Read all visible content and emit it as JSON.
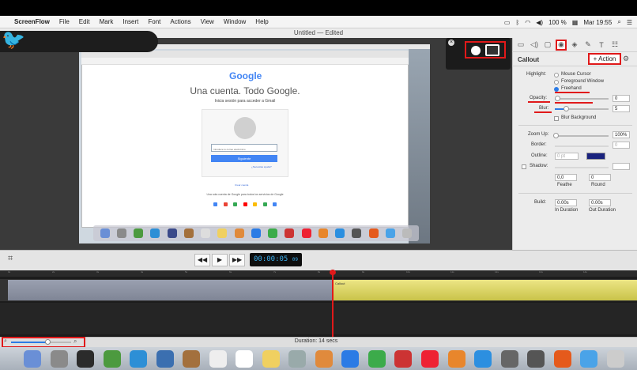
{
  "menubar": {
    "apple": "",
    "app_name": "ScreenFlow",
    "items": [
      "File",
      "Edit",
      "Mark",
      "Insert",
      "Font",
      "Actions",
      "View",
      "Window",
      "Help"
    ],
    "battery": "100 %",
    "clock": "Mar 19:55"
  },
  "window": {
    "title": "Untitled — Edited"
  },
  "browser": {
    "google_logo": "Google",
    "headline": "Una cuenta. Todo Google.",
    "subtitle": "Inicia sesión para acceder a Gmail",
    "email_placeholder": "Introduce tu correo electrónico",
    "next_button": "Siguiente",
    "help_link": "¿Necesitas ayuda?",
    "create_account": "Crear cuenta",
    "one_account_text": "Una sola cuenta de Google para todos los servicios de Google"
  },
  "inspector": {
    "title": "Callout",
    "action_button": "+ Action",
    "highlight_label": "Highlight:",
    "highlight_options": [
      "Mouse Cursor",
      "Foreground Window",
      "Freehand"
    ],
    "highlight_selected": "Freehand",
    "opacity_label": "Opacity:",
    "opacity_value": "0",
    "opacity_fraction": 0.05,
    "blur_label": "Blur:",
    "blur_value": "5",
    "blur_fraction": 0.2,
    "blur_background": "Blur Background",
    "zoom_label": "Zoom Up:",
    "zoom_value": "100%",
    "border_label": "Border:",
    "border_value": "0",
    "outline_label": "Outline:",
    "outline_value": "0 pt",
    "shadow_label": "Shadow:",
    "feather_value": "0,0",
    "feather_label": "Feathe",
    "round_value": "0",
    "round_label": "Round",
    "build_label": "Build:",
    "in_duration_value": "0.00s",
    "in_duration_label": "In Duration",
    "out_duration_value": "0.00s",
    "out_duration_label": "Out Duration",
    "outline_color": "#1a237e"
  },
  "transport": {
    "rewind": "◀◀",
    "play": "▶",
    "forward": "▶▶",
    "timecode": "00:00:05",
    "frames": "09"
  },
  "timeline": {
    "ruler_ticks": [
      "0s",
      "2s",
      "3s",
      "4s",
      "5s",
      "6s",
      "7s",
      "8s",
      "9s",
      "10s",
      "11s",
      "12s",
      "13s",
      "14s"
    ],
    "clip_label": "Callout",
    "duration": "Duration: 14 secs"
  },
  "colors": {
    "accent": "#2b7be5",
    "highlight_red": "#e0191a",
    "timecode_blue": "#3db1f0",
    "callout_clip": "#e3dc72"
  }
}
